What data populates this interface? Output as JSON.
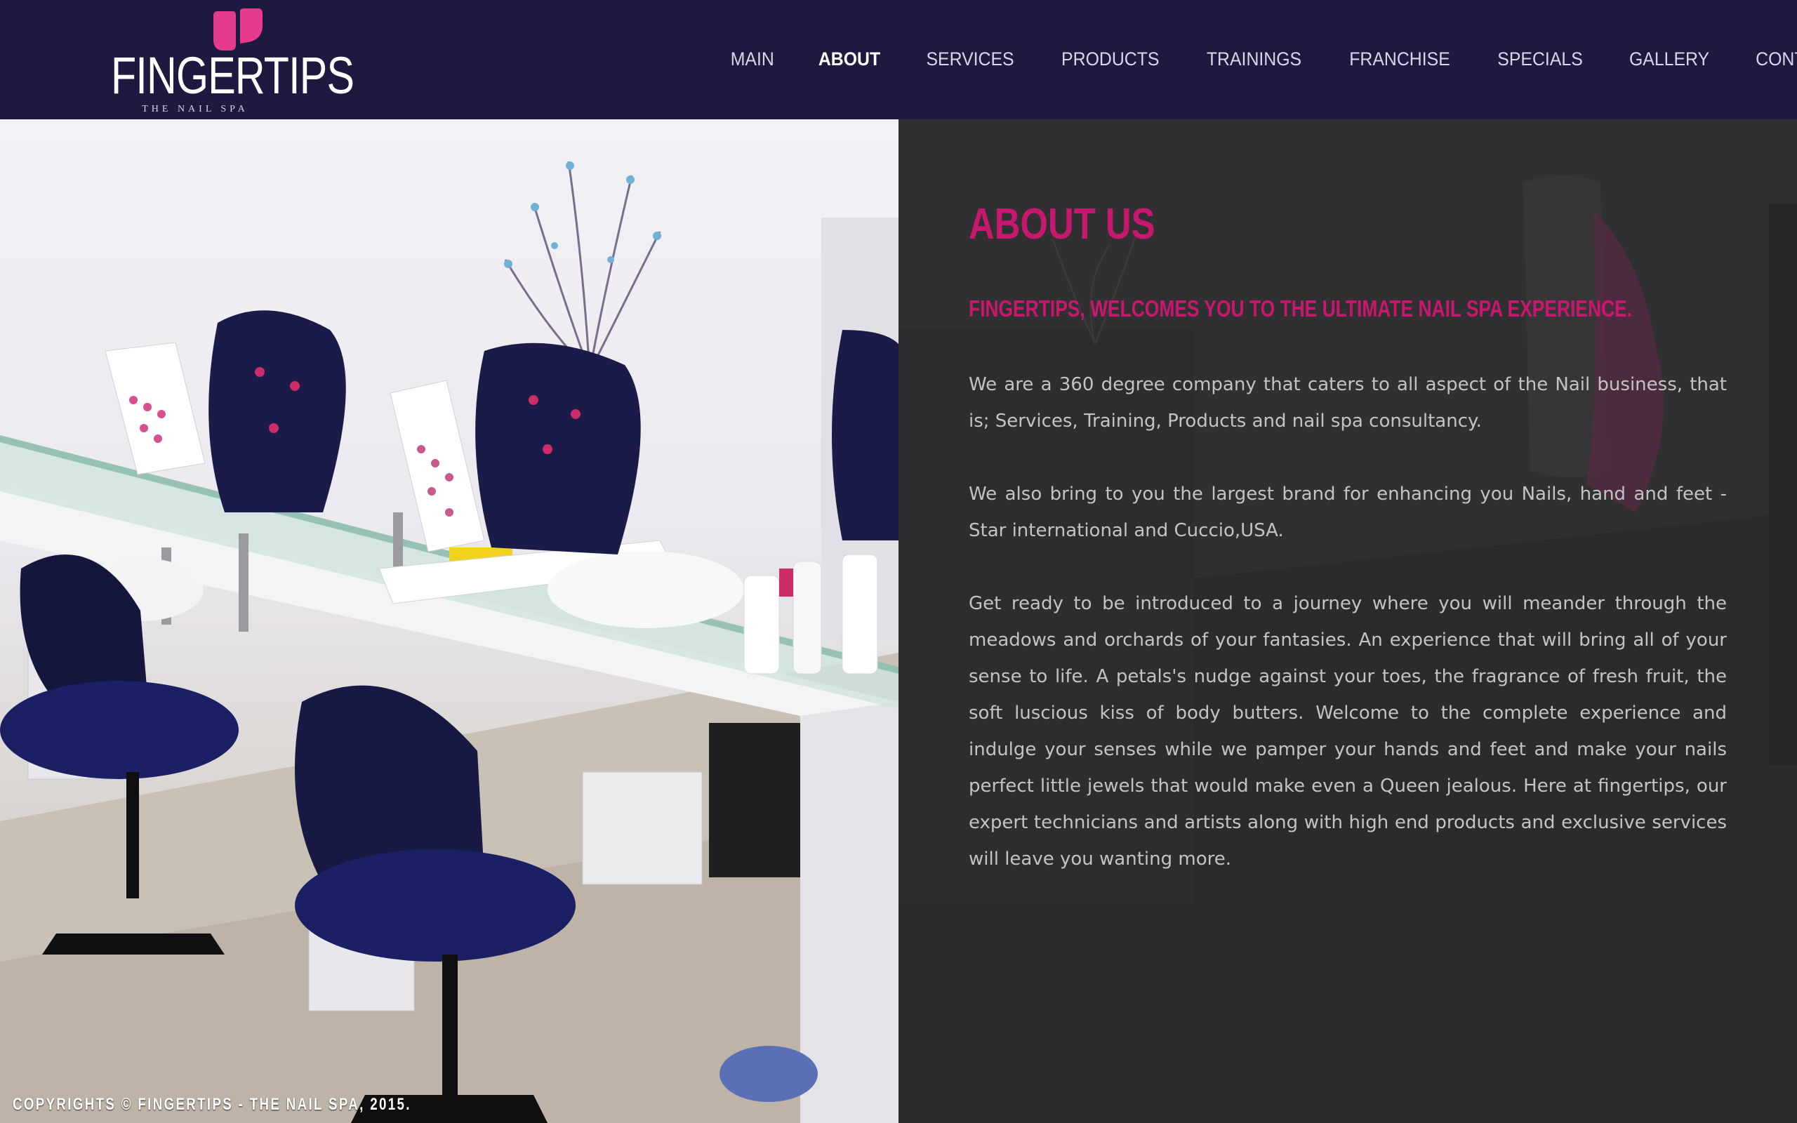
{
  "brand": {
    "name": "FINGERTIPS",
    "tagline": "THE NAIL SPA",
    "accent_color": "#e43b8a"
  },
  "nav": {
    "items": [
      {
        "label": "MAIN"
      },
      {
        "label": "ABOUT",
        "active": true
      },
      {
        "label": "SERVICES"
      },
      {
        "label": "PRODUCTS"
      },
      {
        "label": "TRAININGS"
      },
      {
        "label": "FRANCHISE"
      },
      {
        "label": "SPECIALS"
      },
      {
        "label": "GALLERY"
      },
      {
        "label": "CONTACT"
      }
    ]
  },
  "about": {
    "title": "ABOUT US",
    "welcome": "FINGERTIPS, WELCOMES YOU TO THE ULTIMATE NAIL SPA EXPERIENCE.",
    "paragraphs": [
      "We are a 360 degree company that caters to all aspect of the Nail business, that is; Services, Training, Products and nail spa consultancy.",
      "We also bring to you the largest brand for enhancing you Nails, hand and feet - Star international and Cuccio,USA.",
      "Get ready to be introduced to a journey where you will meander through the meadows and orchards of your fantasies. An experience that will bring all of your sense to life. A petals's nudge against your toes, the fragrance of fresh fruit, the soft luscious kiss of body butters. Welcome to the complete experience and indulge your senses while we pamper your hands and feet and make your nails perfect little jewels that would make even a Queen jealous. Here at fingertips, our expert technicians and artists along with high end products and exclusive services will leave you wanting more."
    ],
    "title_color": "#c8176f"
  },
  "footer": {
    "copyright": "COPYRIGHTS © FINGERTIPS - THE NAIL SPA, 2015."
  },
  "colors": {
    "header_bg": "#1e1a3f",
    "panel_bg": "#2f2f31",
    "body_text": "#c3c3c6"
  }
}
